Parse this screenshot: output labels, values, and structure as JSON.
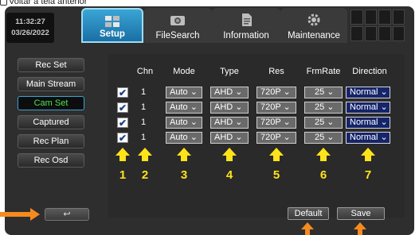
{
  "caption": "Voltar à tela anterior",
  "header": {
    "time": "11:32:27",
    "date": "03/26/2022",
    "tabs": [
      {
        "label": "Setup",
        "icon": "setup-icon",
        "active": true
      },
      {
        "label": "FileSearch",
        "icon": "camera-icon",
        "active": false
      },
      {
        "label": "Information",
        "icon": "document-icon",
        "active": false
      },
      {
        "label": "Maintenance",
        "icon": "gear-icon",
        "active": false
      }
    ]
  },
  "sidebar": {
    "items": [
      {
        "label": "Rec Set",
        "active": false
      },
      {
        "label": "Main Stream",
        "active": false
      },
      {
        "label": "Cam Set",
        "active": true
      },
      {
        "label": "Captured",
        "active": false
      },
      {
        "label": "Rec Plan",
        "active": false
      },
      {
        "label": "Rec Osd",
        "active": false
      }
    ]
  },
  "table": {
    "headers": [
      "Chn",
      "Mode",
      "Type",
      "Res",
      "FrmRate",
      "Direction"
    ],
    "rows": [
      {
        "checked": true,
        "chn": "1",
        "mode": "Auto",
        "type": "AHD",
        "res": "720P",
        "fps": "25",
        "direction": "Normal"
      },
      {
        "checked": true,
        "chn": "1",
        "mode": "Auto",
        "type": "AHD",
        "res": "720P",
        "fps": "25",
        "direction": "Normal"
      },
      {
        "checked": true,
        "chn": "1",
        "mode": "Auto",
        "type": "AHD",
        "res": "720P",
        "fps": "25",
        "direction": "Normal"
      },
      {
        "checked": true,
        "chn": "1",
        "mode": "Auto",
        "type": "AHD",
        "res": "720P",
        "fps": "25",
        "direction": "Normal"
      }
    ]
  },
  "callouts": [
    "1",
    "2",
    "3",
    "4",
    "5",
    "6",
    "7"
  ],
  "buttons": {
    "back": "↩",
    "default": "Default",
    "save": "Save"
  },
  "colors": {
    "active_tab": "#3aa5d6",
    "active_menu_text": "#4ee44e",
    "callout": "#ffe31a",
    "pointer": "#f58a1f",
    "direction_bg": "#16256a"
  }
}
